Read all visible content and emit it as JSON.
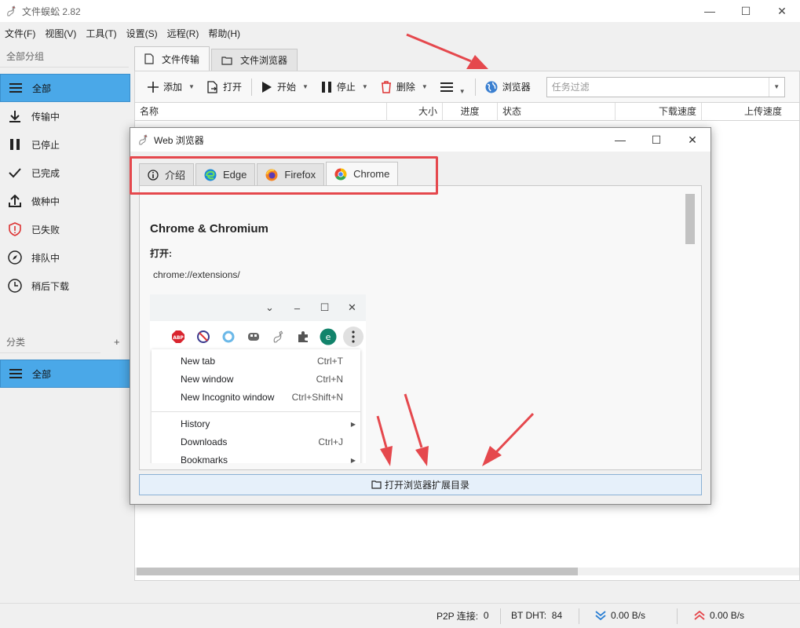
{
  "app": {
    "title": "文件蜈蚣 2.82"
  },
  "menu": [
    "文件(F)",
    "视图(V)",
    "工具(T)",
    "设置(S)",
    "远程(R)",
    "帮助(H)"
  ],
  "sidebar": {
    "groups_header": "全部分组",
    "groups": [
      {
        "label": "全部",
        "icon": "list-icon",
        "active": true
      },
      {
        "label": "传输中",
        "icon": "download-icon"
      },
      {
        "label": "已停止",
        "icon": "pause-icon"
      },
      {
        "label": "已完成",
        "icon": "check-icon"
      },
      {
        "label": "做种中",
        "icon": "upload-icon"
      },
      {
        "label": "已失败",
        "icon": "shield-alert-icon"
      },
      {
        "label": "排队中",
        "icon": "compass-icon"
      },
      {
        "label": "稍后下载",
        "icon": "clock-icon"
      }
    ],
    "categories_header": "分类",
    "categories_add": "+",
    "categories": [
      {
        "label": "全部",
        "icon": "list-icon",
        "active": true
      }
    ]
  },
  "tabs": [
    "文件传输",
    "文件浏览器"
  ],
  "toolbar": {
    "add": "添加",
    "open": "打开",
    "start": "开始",
    "stop": "停止",
    "delete": "删除",
    "browser": "浏览器",
    "filter_placeholder": "任务过滤"
  },
  "table": {
    "columns": [
      "名称",
      "大小",
      "进度",
      "状态",
      "下载速度",
      "上传速度"
    ]
  },
  "statusbar": {
    "p2p_label": "P2P 连接:",
    "p2p_value": "0",
    "dht_label": "BT DHT:",
    "dht_value": "84",
    "down_speed": "0.00 B/s",
    "up_speed": "0.00 B/s"
  },
  "dialog": {
    "title": "Web 浏览器",
    "tabs": [
      "介绍",
      "Edge",
      "Firefox",
      "Chrome"
    ],
    "active_tab": "Chrome",
    "heading": "Chrome & Chromium",
    "open_label": "打开:",
    "url": "chrome://extensions/",
    "chrome_menu": [
      {
        "label": "New tab",
        "shortcut": "Ctrl+T"
      },
      {
        "label": "New window",
        "shortcut": "Ctrl+N"
      },
      {
        "label": "New Incognito window",
        "shortcut": "Ctrl+Shift+N"
      },
      {
        "label": "History",
        "shortcut": ""
      },
      {
        "label": "Downloads",
        "shortcut": "Ctrl+J"
      },
      {
        "label": "Bookmarks",
        "shortcut": ""
      }
    ],
    "open_button": "打开浏览器扩展目录"
  },
  "colors": {
    "accent": "#4aa8e8",
    "annotation": "#e5484d",
    "speed_down": "#2a7fd4",
    "speed_up": "#e5484d"
  }
}
